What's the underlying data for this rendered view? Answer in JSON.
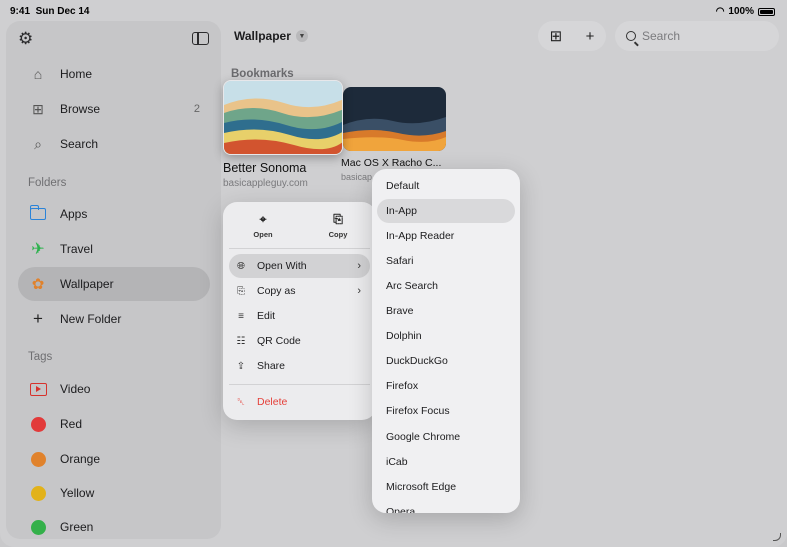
{
  "status": {
    "time": "9:41",
    "date": "Sun Dec 14",
    "battery": "100%"
  },
  "sidebar": {
    "nav": [
      {
        "label": "Home",
        "icon": "house-icon"
      },
      {
        "label": "Browse",
        "icon": "grid-icon",
        "count": "2"
      },
      {
        "label": "Search",
        "icon": "magnifier-icon"
      }
    ],
    "folders_header": "Folders",
    "folders": [
      {
        "label": "Apps",
        "icon": "folder-icon"
      },
      {
        "label": "Travel",
        "icon": "airplane-icon"
      },
      {
        "label": "Wallpaper",
        "icon": "flower-icon",
        "active": true
      },
      {
        "label": "New Folder",
        "icon": "plus-icon"
      }
    ],
    "tags_header": "Tags",
    "tags": [
      {
        "label": "Video",
        "icon": "video-icon",
        "color": "#d7322c"
      },
      {
        "label": "Red",
        "color": "#e23a3a"
      },
      {
        "label": "Orange",
        "color": "#e0822c"
      },
      {
        "label": "Yellow",
        "color": "#e2b21a"
      },
      {
        "label": "Green",
        "color": "#34b04a"
      }
    ]
  },
  "header": {
    "title": "Wallpaper",
    "search_placeholder": "Search"
  },
  "bookmarks": {
    "label": "Bookmarks",
    "items": [
      {
        "title": "Better Sonoma",
        "domain": "basicappleguy.com"
      },
      {
        "title": "Mac OS X Racho C...",
        "domain": "basicap"
      }
    ]
  },
  "context_menu": {
    "top": [
      {
        "label": "Open",
        "icon": "compass-icon"
      },
      {
        "label": "Copy",
        "icon": "copy-icon"
      }
    ],
    "items": [
      {
        "label": "Open With",
        "icon": "globe-icon",
        "submenu": true
      },
      {
        "label": "Copy as",
        "icon": "copy-icon",
        "submenu": true
      },
      {
        "label": "Edit",
        "icon": "sliders-icon"
      },
      {
        "label": "QR Code",
        "icon": "qrcode-icon"
      },
      {
        "label": "Share",
        "icon": "share-icon"
      }
    ],
    "delete": {
      "label": "Delete",
      "icon": "trash-icon"
    }
  },
  "open_with_menu": {
    "items": [
      "Default",
      "In-App",
      "In-App Reader",
      "Safari",
      "Arc Search",
      "Brave",
      "Dolphin",
      "DuckDuckGo",
      "Firefox",
      "Firefox Focus",
      "Google Chrome",
      "iCab",
      "Microsoft Edge",
      "Opera"
    ],
    "highlighted": "In-App"
  }
}
